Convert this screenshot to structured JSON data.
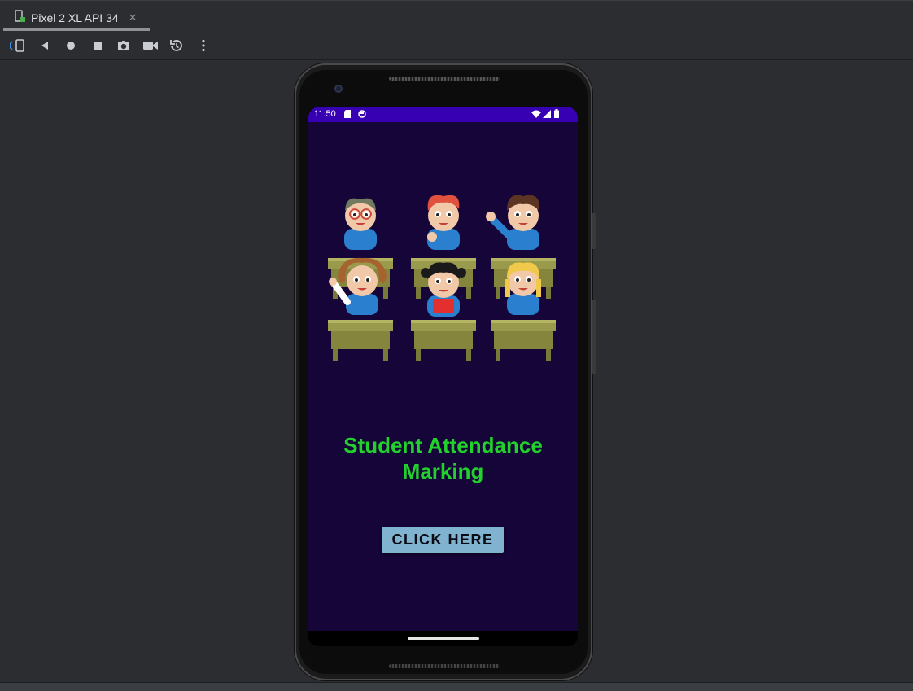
{
  "ide": {
    "device_tab": {
      "label": "Pixel 2 XL API 34",
      "icon": "device-icon",
      "close_icon": "close-icon"
    },
    "toolbar": {
      "buttons": [
        {
          "name": "rotate-device-icon"
        },
        {
          "name": "back-icon"
        },
        {
          "name": "home-icon"
        },
        {
          "name": "overview-icon"
        },
        {
          "name": "camera-icon"
        },
        {
          "name": "screen-record-icon"
        },
        {
          "name": "snapshot-icon"
        },
        {
          "name": "more-icon"
        }
      ]
    }
  },
  "device": {
    "status_bar": {
      "time": "11:50",
      "icons": [
        "sd-card-icon",
        "notification-icon",
        "wifi-icon",
        "signal-icon",
        "battery-icon"
      ]
    },
    "app": {
      "title": "Student Attendance Marking",
      "button_label": "CLICK HERE",
      "illustration": "classroom-students-illustration"
    }
  },
  "colors": {
    "status_bar": "#3700b3",
    "app_background": "#150538",
    "title_text": "#22d12b",
    "button_bg": "#7fb3d0"
  }
}
